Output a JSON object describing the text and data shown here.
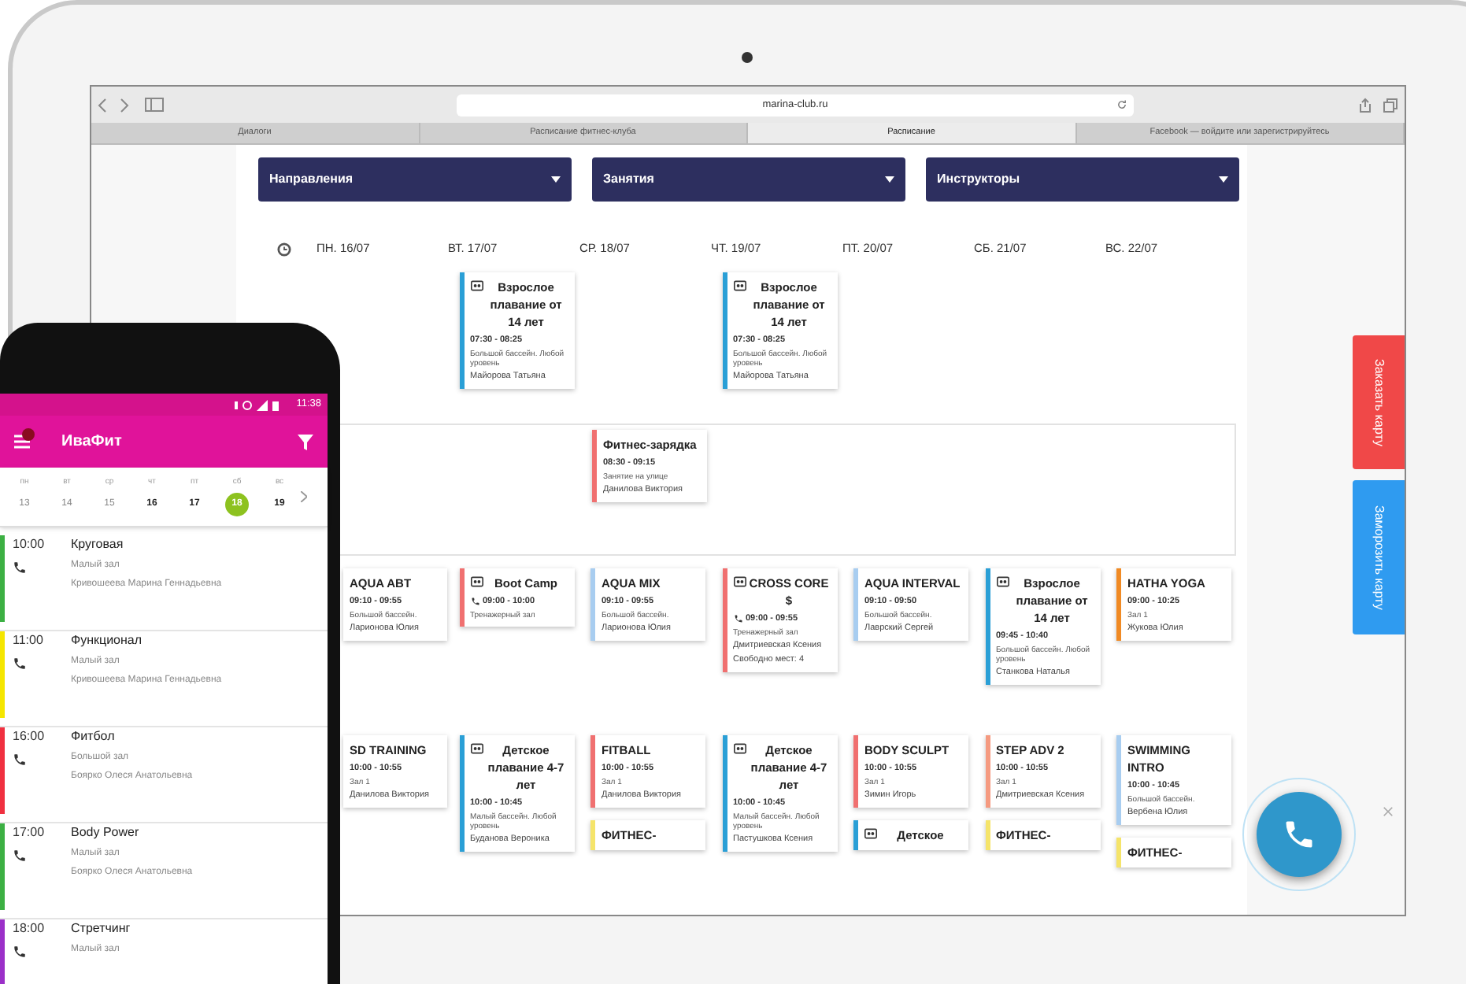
{
  "browser": {
    "url": "marina-club.ru",
    "tabs": [
      {
        "label": "Диалоги",
        "selected": false
      },
      {
        "label": "Расписание фитнес-клуба",
        "selected": false
      },
      {
        "label": "Расписание",
        "selected": true
      },
      {
        "label": "Facebook — войдите или зарегистрируйтесь",
        "selected": false
      }
    ]
  },
  "filters": [
    {
      "label": "Направления"
    },
    {
      "label": "Занятия"
    },
    {
      "label": "Инструкторы"
    }
  ],
  "days": [
    "ПН. 16/07",
    "ВТ. 17/07",
    "СР. 18/07",
    "ЧТ. 19/07",
    "ПТ. 20/07",
    "СБ. 21/07",
    "ВС. 22/07"
  ],
  "rows": [
    {
      "outlined": false,
      "cells": [
        {},
        {
          "cards": [
            {
              "title": "Взрослое плавание от 14 лет",
              "kids_icon": true,
              "phone_icon": false,
              "time": "07:30 - 08:25",
              "place": "Большой бассейн. Любой уровень",
              "trainer": "Майорова Татьяна",
              "color": "#2a9fd6"
            }
          ]
        },
        {},
        {
          "cards": [
            {
              "title": "Взрослое плавание от 14 лет",
              "kids_icon": true,
              "phone_icon": false,
              "time": "07:30 - 08:25",
              "place": "Большой бассейн. Любой уровень",
              "trainer": "Майорова Татьяна",
              "color": "#2a9fd6"
            }
          ]
        },
        {},
        {},
        {}
      ]
    },
    {
      "outlined": true,
      "cells": [
        {},
        {},
        {
          "cards": [
            {
              "title": "Фитнес-зарядка",
              "kids_icon": false,
              "phone_icon": false,
              "time": "08:30 - 09:15",
              "place": "Занятие на улице",
              "trainer": "Данилова Виктория",
              "color": "#f07070"
            }
          ]
        },
        {},
        {},
        {},
        {}
      ]
    },
    {
      "outlined": false,
      "cells": [
        {
          "cards": [
            {
              "title": "AQUA ABT",
              "kids_icon": false,
              "phone_icon": false,
              "time": "09:10 - 09:55",
              "place": "Большой бассейн.",
              "trainer": "Ларионова Юлия"
            }
          ]
        },
        {
          "cards": [
            {
              "title": "Boot Camp",
              "kids_icon": true,
              "phone_icon": true,
              "time": "09:00 - 10:00",
              "place": "Тренажерный зал",
              "color": "#f07070"
            }
          ]
        },
        {
          "cards": [
            {
              "title": "AQUA MIX",
              "kids_icon": false,
              "phone_icon": false,
              "time": "09:10 - 09:55",
              "place": "Большой бассейн.",
              "trainer": "Ларионова Юлия",
              "color": "#a8cdf0"
            }
          ]
        },
        {
          "cards": [
            {
              "title": "CROSS CORE $",
              "kids_icon": true,
              "phone_icon": true,
              "time": "09:00 - 09:55",
              "place": "Тренажерный зал",
              "trainer": "Дмитриевская Ксения",
              "extra": "Свободно мест: 4",
              "color": "#f07070"
            }
          ]
        },
        {
          "cards": [
            {
              "title": "AQUA INTERVAL",
              "kids_icon": false,
              "phone_icon": false,
              "time": "09:10 - 09:50",
              "place": "Большой бассейн.",
              "trainer": "Лаврский Сергей",
              "color": "#a8cdf0"
            }
          ]
        },
        {
          "cards": [
            {
              "title": "Взрослое плавание от 14 лет",
              "kids_icon": true,
              "phone_icon": false,
              "time": "09:45 - 10:40",
              "place": "Большой бассейн. Любой уровень",
              "trainer": "Станкова Наталья",
              "color": "#2a9fd6"
            }
          ]
        },
        {
          "cards": [
            {
              "title": "HATHA YOGA",
              "kids_icon": false,
              "phone_icon": false,
              "time": "09:00 - 10:25",
              "place": "Зал 1",
              "trainer": "Жукова Юлия",
              "color": "#f08a24"
            }
          ]
        }
      ]
    },
    {
      "outlined": false,
      "cells": [
        {
          "cards": [
            {
              "title": "SD TRAINING",
              "kids_icon": false,
              "phone_icon": false,
              "time": "10:00 - 10:55",
              "place": "Зал 1",
              "trainer": "Данилова Виктория"
            }
          ]
        },
        {
          "cards": [
            {
              "title": "Детское плавание 4-7 лет",
              "kids_icon": true,
              "phone_icon": false,
              "time": "10:00 - 10:45",
              "place": "Малый бассейн. Любой уровень",
              "trainer": "Буданова Вероника",
              "color": "#2a9fd6"
            }
          ]
        },
        {
          "cards": [
            {
              "title": "FITBALL",
              "kids_icon": false,
              "phone_icon": false,
              "time": "10:00 - 10:55",
              "place": "Зал 1",
              "trainer": "Данилова Виктория",
              "color": "#f07070"
            },
            {
              "title": "ФИТНЕС-",
              "kids_icon": false,
              "phone_icon": false,
              "color": "#f5e46a"
            }
          ]
        },
        {
          "cards": [
            {
              "title": "Детское плавание 4-7 лет",
              "kids_icon": true,
              "phone_icon": false,
              "time": "10:00 - 10:45",
              "place": "Малый бассейн. Любой уровень",
              "trainer": "Пастушкова Ксения",
              "color": "#2a9fd6"
            }
          ]
        },
        {
          "cards": [
            {
              "title": "BODY SCULPT",
              "kids_icon": false,
              "phone_icon": false,
              "time": "10:00 - 10:55",
              "place": "Зал 1",
              "trainer": "Зимин Игорь",
              "color": "#f07070"
            },
            {
              "title": "Детское",
              "kids_icon": true,
              "phone_icon": false,
              "color": "#2a9fd6"
            }
          ]
        },
        {
          "cards": [
            {
              "title": "STEP ADV 2",
              "kids_icon": false,
              "phone_icon": false,
              "time": "10:00 - 10:55",
              "place": "Зал 1",
              "trainer": "Дмитриевская Ксения",
              "color": "#f59a80"
            },
            {
              "title": "ФИТНЕС-",
              "kids_icon": false,
              "phone_icon": false,
              "color": "#f5e46a"
            }
          ]
        },
        {
          "cards": [
            {
              "title": "SWIMMING INTRO",
              "kids_icon": false,
              "phone_icon": false,
              "time": "10:00 - 10:45",
              "place": "Большой бассейн.",
              "trainer": "Вербена Юлия",
              "color": "#a8cdf0"
            },
            {
              "title": "ФИТНЕС-",
              "kids_icon": false,
              "phone_icon": false,
              "color": "#f5e46a"
            }
          ]
        }
      ]
    }
  ],
  "side_buttons": [
    {
      "label": "Заказать карту",
      "color": "#f04848"
    },
    {
      "label": "Заморозить карту",
      "color": "#2f9bf0"
    }
  ],
  "phone": {
    "clock": "11:38",
    "app_title": "ИваФит",
    "notification": true,
    "dates": [
      {
        "dow": "пн",
        "date": "13",
        "past": true,
        "selected": false
      },
      {
        "dow": "вт",
        "date": "14",
        "past": true,
        "selected": false
      },
      {
        "dow": "ср",
        "date": "15",
        "past": true,
        "selected": false
      },
      {
        "dow": "чт",
        "date": "16",
        "past": false,
        "selected": false
      },
      {
        "dow": "пт",
        "date": "17",
        "past": false,
        "selected": false
      },
      {
        "dow": "сб",
        "date": "18",
        "past": false,
        "selected": true
      },
      {
        "dow": "вс",
        "date": "19",
        "past": false,
        "selected": false
      }
    ],
    "classes": [
      {
        "time": "10:00",
        "title": "Круговая",
        "room": "Малый зал",
        "trainer": "Кривошеева Марина Геннадьевна",
        "color": "#3cb043"
      },
      {
        "time": "11:00",
        "title": "Функционал",
        "room": "Малый зал",
        "trainer": "Кривошеева Марина Геннадьевна",
        "color": "#f5e600"
      },
      {
        "time": "16:00",
        "title": "Фитбол",
        "room": "Большой зал",
        "trainer": "Боярко Олеся Анатольевна",
        "color": "#f03040"
      },
      {
        "time": "17:00",
        "title": "Body Power",
        "room": "Малый зал",
        "trainer": "Боярко Олеся Анатольевна",
        "color": "#3cb043"
      },
      {
        "time": "18:00",
        "title": "Стретчинг",
        "room": "Малый зал",
        "color": "#9b30c8"
      }
    ]
  }
}
